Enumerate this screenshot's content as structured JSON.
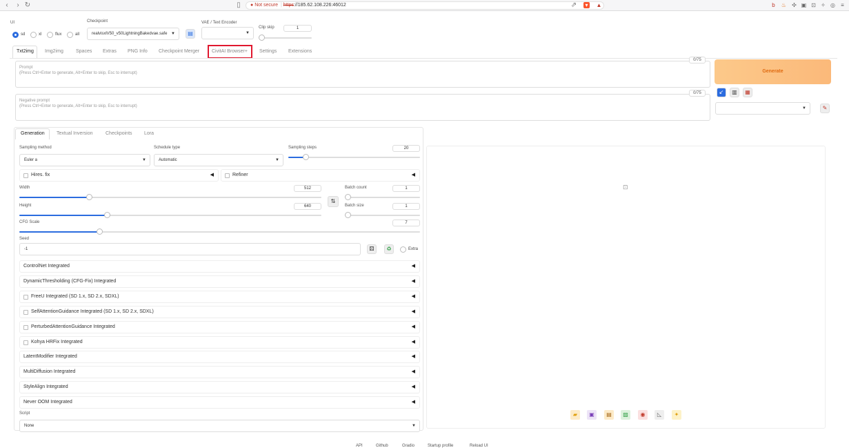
{
  "browser": {
    "not_secure": "Not secure",
    "protocol": "https",
    "url_rest": "://185.62.108.226:46012"
  },
  "ui_mode": {
    "label": "UI",
    "options": [
      "sd",
      "xl",
      "flux",
      "all"
    ],
    "selected": "sd"
  },
  "checkpoint": {
    "label": "Checkpoint",
    "value": "realvisxlV50_v50LightningBakedvae.safe"
  },
  "vae": {
    "label": "VAE / Text Encoder",
    "value": ""
  },
  "clip_skip": {
    "label": "Clip skip",
    "value": "1"
  },
  "main_tabs": [
    "Txt2img",
    "Img2img",
    "Spaces",
    "Extras",
    "PNG Info",
    "Checkpoint Merger",
    "CivitAI Browser+",
    "Settings",
    "Extensions"
  ],
  "prompt": {
    "label": "Prompt",
    "hint": "(Press Ctrl+Enter to generate, Alt+Enter to skip, Esc to interrupt)",
    "tokens": "0/75"
  },
  "negative_prompt": {
    "label": "Negative prompt",
    "hint": "(Press Ctrl+Enter to generate, Alt+Enter to skip, Esc to interrupt)",
    "tokens": "0/75"
  },
  "generate_label": "Generate",
  "sub_tabs": [
    "Generation",
    "Textual Inversion",
    "Checkpoints",
    "Lora"
  ],
  "sampling": {
    "method_label": "Sampling method",
    "method_value": "Euler a",
    "schedule_label": "Schedule type",
    "schedule_value": "Automatic",
    "steps_label": "Sampling steps",
    "steps_value": "20",
    "steps_fraction": 0.13
  },
  "hires_fix": "Hires. fix",
  "refiner": "Refiner",
  "width": {
    "label": "Width",
    "value": "512",
    "fraction": 0.23
  },
  "height": {
    "label": "Height",
    "value": "640",
    "fraction": 0.29
  },
  "batch_count": {
    "label": "Batch count",
    "value": "1"
  },
  "batch_size": {
    "label": "Batch size",
    "value": "1"
  },
  "cfg": {
    "label": "CFG Scale",
    "value": "7",
    "fraction": 0.2
  },
  "seed": {
    "label": "Seed",
    "value": "-1",
    "extra_label": "Extra"
  },
  "accordions": [
    {
      "label": "ControlNet Integrated",
      "checkbox": false
    },
    {
      "label": "DynamicThresholding (CFG-Fix) Integrated",
      "checkbox": false
    },
    {
      "label": "FreeU Integrated (SD 1.x, SD 2.x, SDXL)",
      "checkbox": true
    },
    {
      "label": "SelfAttentionGuidance Integrated (SD 1.x, SD 2.x, SDXL)",
      "checkbox": true
    },
    {
      "label": "PerturbedAttentionGuidance Integrated",
      "checkbox": true
    },
    {
      "label": "Kohya HRFix Integrated",
      "checkbox": true
    },
    {
      "label": "LatentModifier Integrated",
      "checkbox": false
    },
    {
      "label": "MultiDiffusion Integrated",
      "checkbox": false
    },
    {
      "label": "StyleAlign Integrated",
      "checkbox": false
    },
    {
      "label": "Never OOM Integrated",
      "checkbox": false
    }
  ],
  "script": {
    "label": "Script",
    "value": "None"
  },
  "footer": [
    "API",
    "Github",
    "Gradio",
    "Startup profile",
    "Reload UI"
  ],
  "colors": {
    "accent": "#2b6cdf",
    "generate_bg": "#fbb97a",
    "highlight": "#e0172e"
  }
}
